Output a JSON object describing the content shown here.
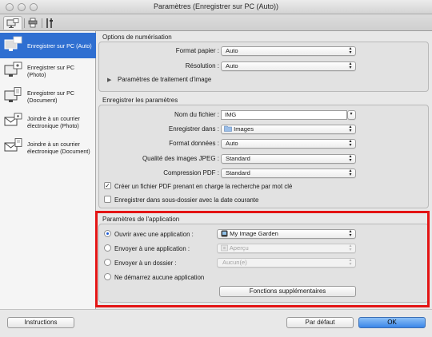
{
  "window": {
    "title": "Paramètres (Enregistrer sur PC (Auto))"
  },
  "toolbar": {
    "tabs": [
      {
        "icon": "computer-scan-icon",
        "active": true
      },
      {
        "icon": "scanner-icon",
        "active": false
      },
      {
        "icon": "tools-icon",
        "active": false
      }
    ]
  },
  "sidebar": {
    "items": [
      {
        "label": "Enregistrer sur PC (Auto)",
        "icon": "computer-scan-icon",
        "selected": true
      },
      {
        "label": "Enregistrer sur PC (Photo)",
        "icon": "computer-photo-icon",
        "selected": false
      },
      {
        "label": "Enregistrer sur PC (Document)",
        "icon": "computer-document-icon",
        "selected": false
      },
      {
        "label": "Joindre à un courrier électronique (Photo)",
        "icon": "mail-photo-icon",
        "selected": false
      },
      {
        "label": "Joindre à un courrier électronique (Document)",
        "icon": "mail-document-icon",
        "selected": false
      }
    ]
  },
  "scan_options": {
    "title": "Options de numérisation",
    "paper_size_label": "Format papier :",
    "paper_size_value": "Auto",
    "resolution_label": "Résolution :",
    "resolution_value": "Auto",
    "image_processing_label": "Paramètres de traitement d'image"
  },
  "save_settings": {
    "title": "Enregistrer les paramètres",
    "filename_label": "Nom du fichier :",
    "filename_value": "IMG",
    "save_in_label": "Enregistrer dans :",
    "save_in_value": "Images",
    "data_format_label": "Format données :",
    "data_format_value": "Auto",
    "jpeg_quality_label": "Qualité des images JPEG :",
    "jpeg_quality_value": "Standard",
    "pdf_compression_label": "Compression PDF :",
    "pdf_compression_value": "Standard",
    "searchable_pdf_label": "Créer un fichier PDF prenant en charge la recherche par mot clé",
    "searchable_pdf_checked": true,
    "subfolder_label": "Enregistrer dans sous-dossier avec la date courante",
    "subfolder_checked": false
  },
  "app_settings": {
    "title": "Paramètres de l'application",
    "open_with_label": "Ouvrir avec une application :",
    "open_with_value": "My Image Garden",
    "send_app_label": "Envoyer à une application :",
    "send_app_value": "Aperçu",
    "send_folder_label": "Envoyer à un dossier :",
    "send_folder_value": "Aucun(e)",
    "no_app_label": "Ne démarrez aucune application",
    "selected_option": "open_with",
    "more_functions_label": "Fonctions supplémentaires"
  },
  "footer": {
    "instructions_label": "Instructions",
    "defaults_label": "Par défaut",
    "ok_label": "OK"
  },
  "colors": {
    "selection_blue": "#2f6fd1",
    "highlight_red": "#e31414",
    "default_button": "#3a86e8"
  }
}
